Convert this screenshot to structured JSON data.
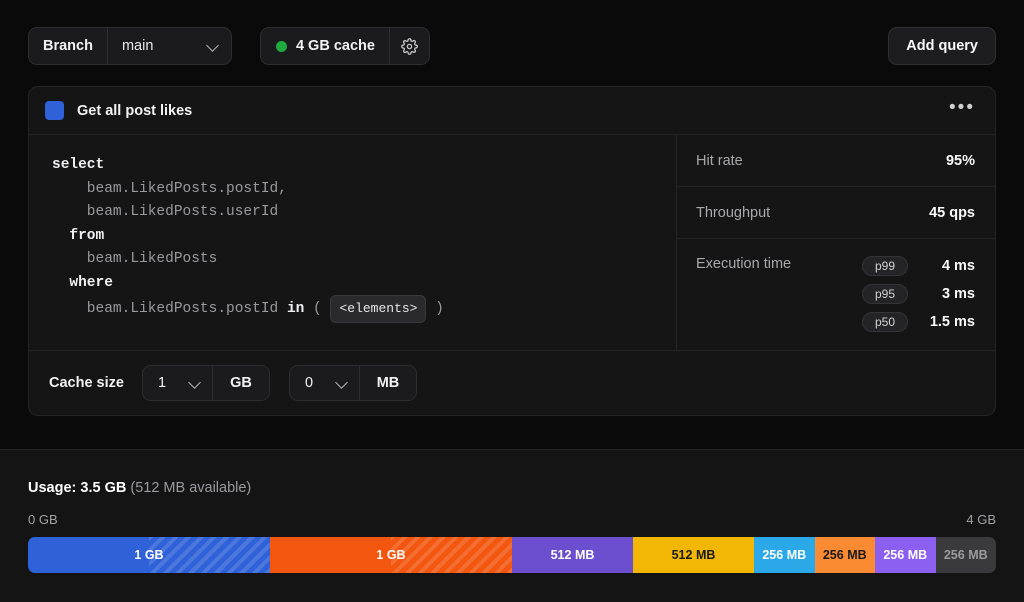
{
  "toolbar": {
    "branch_label": "Branch",
    "branch_value": "main",
    "branch_chevron_icon": "chevron-down-icon",
    "cache_status_dot_color": "#1faa3f",
    "cache_status_label": "4 GB cache",
    "settings_icon": "gear-icon",
    "add_query_label": "Add query"
  },
  "query_card": {
    "icon": "blue-square-icon",
    "title": "Get all post likes",
    "menu_icon": "ellipsis-icon",
    "accent_color": "#2f62d8",
    "sql": {
      "lines": [
        {
          "indent": 0,
          "tokens": [
            {
              "t": "select",
              "kw": true
            }
          ]
        },
        {
          "indent": 4,
          "tokens": [
            {
              "t": "beam.LikedPosts.postId,",
              "kw": false
            }
          ]
        },
        {
          "indent": 4,
          "tokens": [
            {
              "t": "beam.LikedPosts.userId",
              "kw": false
            }
          ]
        },
        {
          "indent": 2,
          "tokens": [
            {
              "t": "from",
              "kw": true
            }
          ]
        },
        {
          "indent": 4,
          "tokens": [
            {
              "t": "beam.LikedPosts",
              "kw": false
            }
          ]
        },
        {
          "indent": 2,
          "tokens": [
            {
              "t": "where",
              "kw": true
            }
          ]
        }
      ],
      "last_line": {
        "indent": 4,
        "prefix": "beam.LikedPosts.postId ",
        "keyword": "in",
        "open_paren": " ( ",
        "chip": "<elements>",
        "close_paren": " )"
      }
    },
    "metrics": [
      {
        "label": "Hit rate",
        "value": "95%"
      },
      {
        "label": "Throughput",
        "value": "45 qps"
      }
    ],
    "execution": {
      "label": "Execution time",
      "rows": [
        {
          "percentile": "p99",
          "value": "4 ms"
        },
        {
          "percentile": "p95",
          "value": "3 ms"
        },
        {
          "percentile": "p50",
          "value": "1.5 ms"
        }
      ]
    },
    "cache_size": {
      "label": "Cache size",
      "gb_value": "1",
      "gb_unit": "GB",
      "mb_value": "0",
      "mb_unit": "MB",
      "chevron_icon": "chevron-down-icon"
    }
  },
  "usage": {
    "prefix": "Usage:",
    "total": "3.5 GB",
    "available": "(512 MB available)",
    "scale_min": "0 GB",
    "scale_max": "4 GB",
    "segments": [
      {
        "label": "1 GB",
        "color": "#2f62d8",
        "text_color": "#ffffff",
        "width_pct": 25.0,
        "striped": true
      },
      {
        "label": "1 GB",
        "color": "#f2560f",
        "text_color": "#ffffff",
        "width_pct": 25.0,
        "striped": true
      },
      {
        "label": "512 MB",
        "color": "#6b4fce",
        "text_color": "#ffffff",
        "width_pct": 12.5,
        "striped": false
      },
      {
        "label": "512 MB",
        "color": "#f2b705",
        "text_color": "#1a1a1a",
        "width_pct": 12.5,
        "striped": false
      },
      {
        "label": "256 MB",
        "color": "#2aa8e8",
        "text_color": "#ffffff",
        "width_pct": 6.25,
        "striped": false
      },
      {
        "label": "256 MB",
        "color": "#fb8b33",
        "text_color": "#1a1a1a",
        "width_pct": 6.25,
        "striped": false
      },
      {
        "label": "256 MB",
        "color": "#8b60f0",
        "text_color": "#ffffff",
        "width_pct": 6.25,
        "striped": false
      },
      {
        "label": "256 MB",
        "color": "#3a3a3c",
        "text_color": "#9b9b9f",
        "width_pct": 6.25,
        "striped": false
      }
    ]
  }
}
